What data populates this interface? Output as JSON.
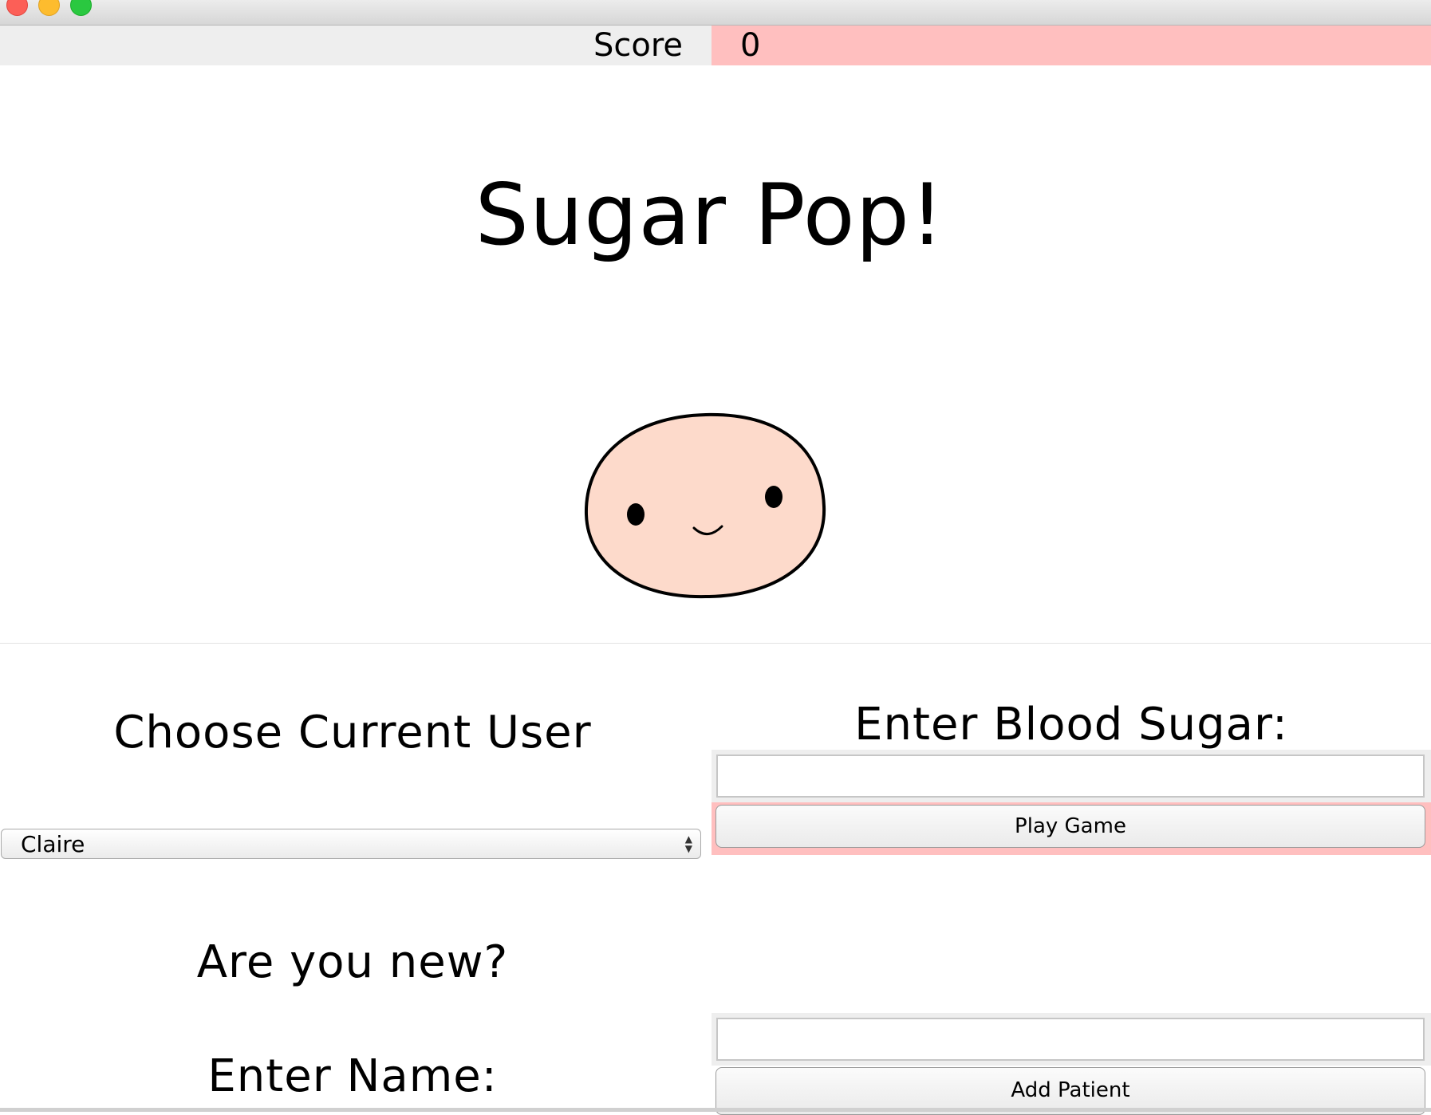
{
  "window": {
    "controls": [
      "close",
      "minimize",
      "maximize"
    ]
  },
  "score": {
    "label": "Score",
    "value": "0",
    "highlight_color": "#ffbfbf"
  },
  "app": {
    "title": "Sugar Pop!",
    "character_icon": "smiling-face-blob"
  },
  "left_panel": {
    "choose_user_heading": "Choose Current User",
    "selected_user": "Claire",
    "new_user_heading": "Are you new?",
    "enter_name_heading": "Enter Name:"
  },
  "right_panel": {
    "blood_sugar_heading": "Enter Blood Sugar:",
    "blood_sugar_value": "",
    "play_button": "Play Game",
    "name_value": "",
    "add_button": "Add Patient"
  }
}
